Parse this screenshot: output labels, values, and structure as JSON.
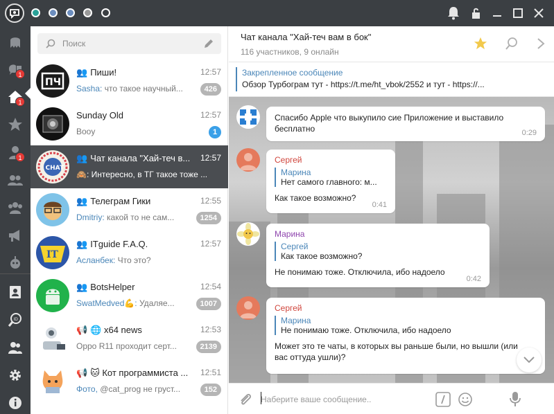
{
  "titlebar": {
    "dots": [
      "#2aa198",
      "#6c8ebf",
      "#6c8ebf",
      "#9a9a9a",
      "#3b3f43"
    ],
    "icons": [
      "bell-icon",
      "lock-icon",
      "minimize-icon",
      "maximize-icon",
      "close-icon"
    ]
  },
  "rail": {
    "items": [
      {
        "icon": "ghost-icon",
        "badge": ""
      },
      {
        "icon": "chats-icon",
        "badge": "1"
      },
      {
        "icon": "home-icon",
        "badge": "1"
      },
      {
        "icon": "star-icon",
        "badge": ""
      },
      {
        "icon": "user-icon",
        "badge": "1"
      },
      {
        "icon": "group-icon",
        "badge": ""
      },
      {
        "icon": "supergroup-icon",
        "badge": ""
      },
      {
        "icon": "megaphone-icon",
        "badge": ""
      },
      {
        "icon": "bot-icon",
        "badge": ""
      },
      {
        "icon": "contacts-icon",
        "badge": ""
      },
      {
        "icon": "search-id-icon",
        "badge": ""
      },
      {
        "icon": "people-icon",
        "badge": ""
      },
      {
        "icon": "settings-icon",
        "badge": ""
      },
      {
        "icon": "info-icon",
        "badge": ""
      }
    ]
  },
  "search": {
    "placeholder": "Поиск"
  },
  "chats": [
    {
      "kind": "group",
      "title": "Пиши!",
      "time": "12:57",
      "sender": "Sasha:",
      "preview": "что такое научный...",
      "badge": "426",
      "badge_color": "grey"
    },
    {
      "kind": "",
      "title": "Sunday Old",
      "time": "12:57",
      "sender": "",
      "preview": "Booy",
      "badge": "1",
      "badge_color": "blue"
    },
    {
      "kind": "group",
      "title": "Чат канала \"Хай-теч в...",
      "time": "12:57",
      "sender": "",
      "preview": "🙈: Интересно, в ТГ такое тоже ...",
      "badge": "",
      "badge_color": ""
    },
    {
      "kind": "group",
      "title": "Телеграм Гики",
      "time": "12:55",
      "sender": "Dmitriy:",
      "preview": "какой то не сам...",
      "badge": "1254",
      "badge_color": "grey"
    },
    {
      "kind": "group",
      "title": "ITguide F.A.Q.",
      "time": "12:57",
      "sender": "Асланбек:",
      "preview": "Что это?",
      "badge": "",
      "badge_color": ""
    },
    {
      "kind": "group",
      "title": "BotsHelper",
      "time": "12:54",
      "sender": "SwatMedved💪:",
      "preview": "Удаляе...",
      "badge": "1007",
      "badge_color": "grey"
    },
    {
      "kind": "channel",
      "title": "🌐 x64 news",
      "time": "12:53",
      "sender": "",
      "preview": "Oppo R11 проходит серт...",
      "badge": "2139",
      "badge_color": "grey"
    },
    {
      "kind": "channel",
      "title": "🐱 Кот программиста ...",
      "time": "12:51",
      "sender": "Фото,",
      "preview": "@cat_prog не груст...",
      "badge": "152",
      "badge_color": "grey"
    }
  ],
  "chat_header": {
    "name": "Чат канала \"Хай-теч вам в бок\"",
    "members": "116 участников, 9 онлайн"
  },
  "pinned": {
    "label": "Закрепленное сообщение",
    "text": "Обзор Турбограм тут - https://t.me/ht_vbok/2552 и тут - https://..."
  },
  "messages": [
    {
      "from": "",
      "from_color": "",
      "reply_name": "",
      "reply_text": "",
      "text": "Спасибо Apple что выкупило сие Приложение и выставило бесплатно",
      "time": "0:29"
    },
    {
      "from": "Сергей",
      "from_color": "#d0453c",
      "reply_name": "Марина",
      "reply_text": "Нет самого главного: м...",
      "text": "Как такое возможно?",
      "time": "0:41"
    },
    {
      "from": "Марина",
      "from_color": "#8e44ad",
      "reply_name": "Сергей",
      "reply_text": "Как такое возможно?",
      "text": "Не понимаю тоже. Отключила, ибо надоело",
      "time": "0:42"
    },
    {
      "from": "Сергей",
      "from_color": "#d0453c",
      "reply_name": "Марина",
      "reply_text": "Не понимаю тоже. Отключила, ибо надоело",
      "text": "Может это те чаты, в которых вы раньше были, но вышли (или вас оттуда ушли)?",
      "time": ""
    }
  ],
  "compose": {
    "placeholder": "Наберите ваше сообщение.."
  },
  "colors": {
    "accent": "#4a86b8",
    "sidebar": "#3b3f43",
    "active_row": "#4a4d51",
    "unread_grey": "#b5b5b5",
    "unread_blue": "#3aa0e8"
  }
}
